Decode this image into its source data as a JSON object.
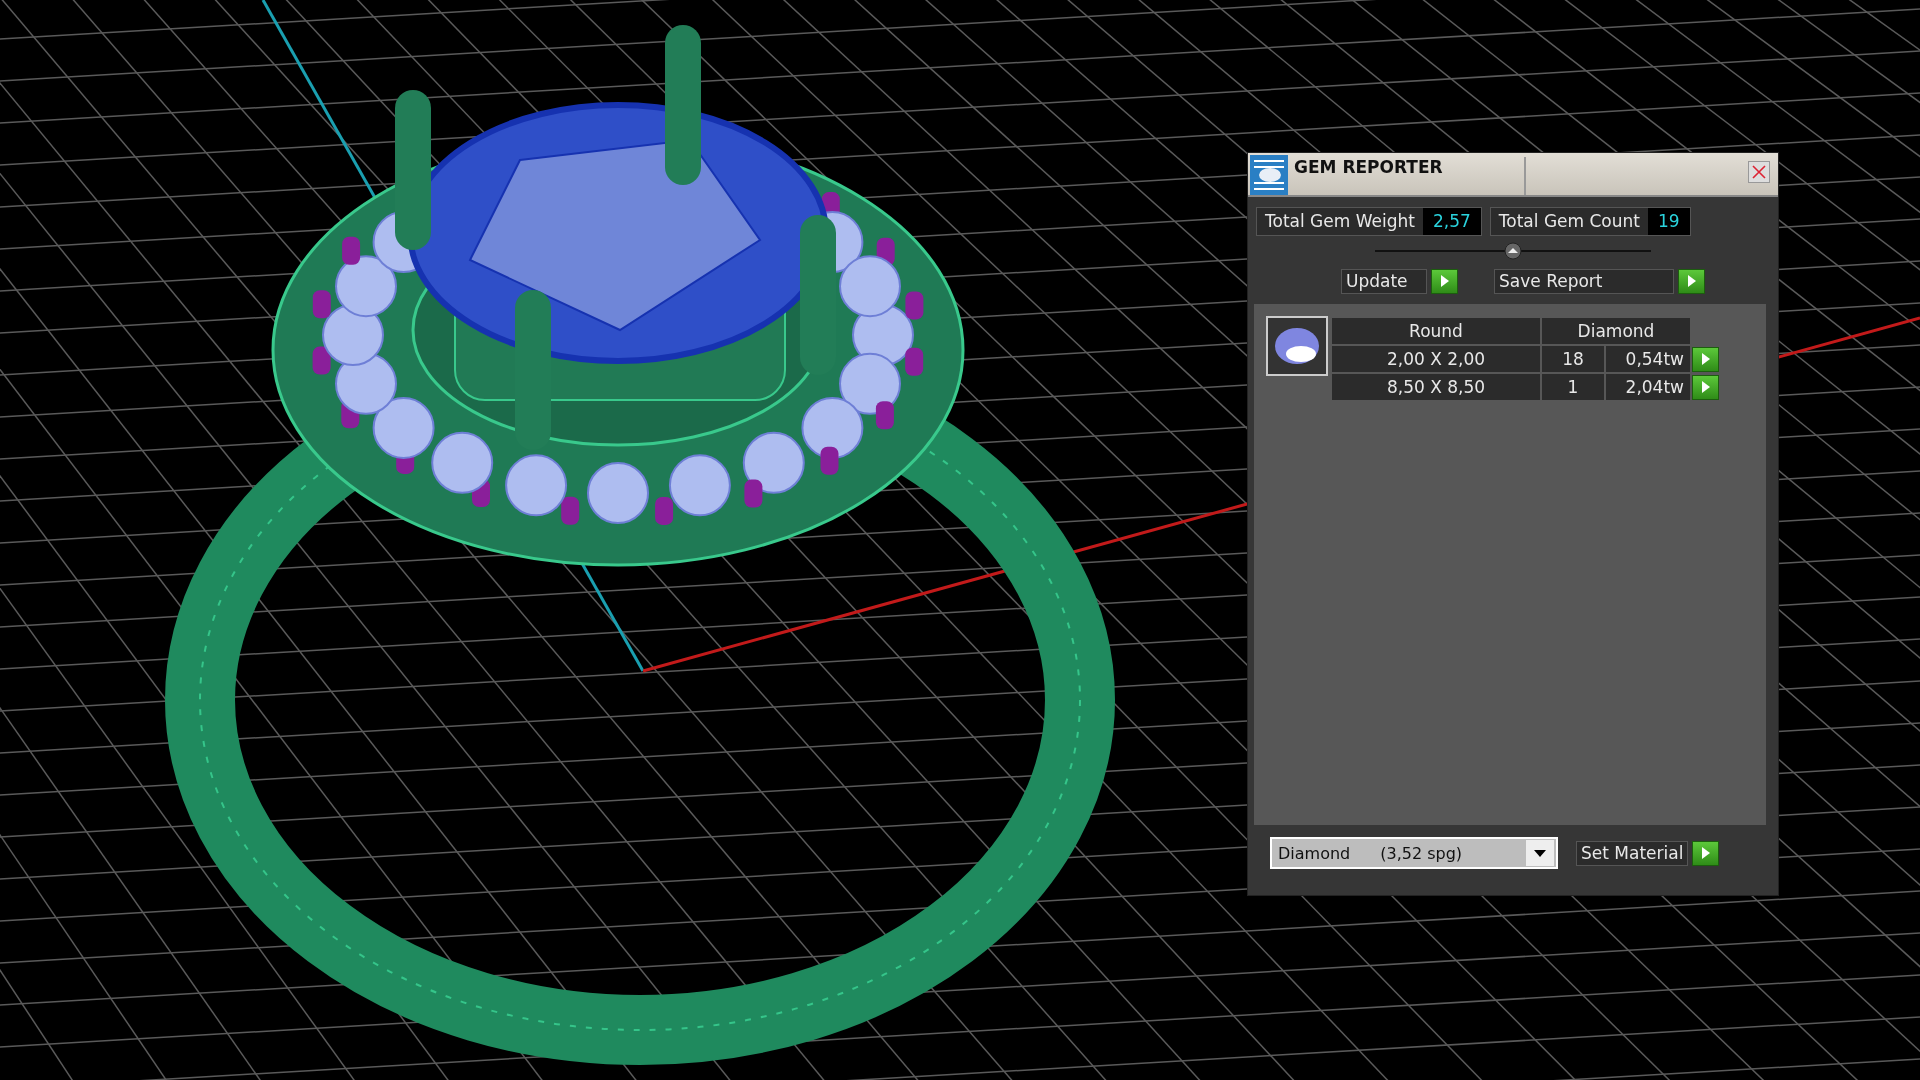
{
  "window": {
    "title": "GEM REPORTER"
  },
  "totals": [
    {
      "label": "Total Gem Weight",
      "value": "2,57"
    },
    {
      "label": "Total Gem Count",
      "value": "19"
    }
  ],
  "actions": [
    {
      "label": "Update"
    },
    {
      "label": "Save Report"
    }
  ],
  "table": {
    "header": [
      "Round",
      "Diamond"
    ],
    "rows": [
      {
        "size": "2,00 X 2,00",
        "count": "18",
        "weight": "0,54tw"
      },
      {
        "size": "8,50 X 8,50",
        "count": "1",
        "weight": "2,04tw"
      }
    ]
  },
  "material": {
    "name": "Diamond",
    "density": "(3,52 spg)"
  },
  "set_button": {
    "label": "Set Material"
  }
}
